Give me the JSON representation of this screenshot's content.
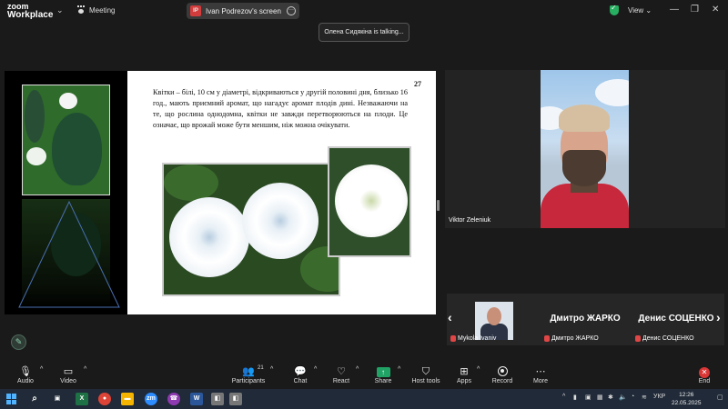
{
  "app": {
    "logo_line1": "zoom",
    "logo_line2": "Workplace",
    "meeting_label": "Meeting",
    "share_initials": "IP",
    "share_title": "Ivan Podrezov's screen",
    "view_label": "View",
    "talking_text": "Олена Сидякіна is talking..."
  },
  "slide": {
    "page_number": "27",
    "text": "Квітки – білі, 10 см у діаметрі, відкриваються у другій половині дня, близько 16 год., мають приємний аромат, що нагадує аромат плодів дині. Незважаючи на те, що рослина однодомна, квітки не завжди перетворюються на плоди. Це означає, що врожай може бути меншим, ніж можна очікувати."
  },
  "video": {
    "main_name": "Viktor Zeleniuk",
    "gallery": [
      {
        "big": "",
        "small": "Mykola Ivaniv"
      },
      {
        "big": "Дмитро ЖАРКО",
        "small": "Дмитро ЖАРКО"
      },
      {
        "big": "Денис СОЦЕНКО",
        "small": "Денис СОЦЕНКО"
      }
    ]
  },
  "toolbar": {
    "audio": "Audio",
    "video": "Video",
    "participants": "Participants",
    "participants_count": "21",
    "chat": "Chat",
    "react": "React",
    "share": "Share",
    "host_tools": "Host tools",
    "apps": "Apps",
    "record": "Record",
    "more": "More",
    "end": "End"
  },
  "taskbar": {
    "language": "УКР",
    "time": "12:26",
    "date": "22.05.2025"
  },
  "colors": {
    "share_green": "#21a366",
    "end_red": "#d93636",
    "shield_green": "#27ae60"
  }
}
